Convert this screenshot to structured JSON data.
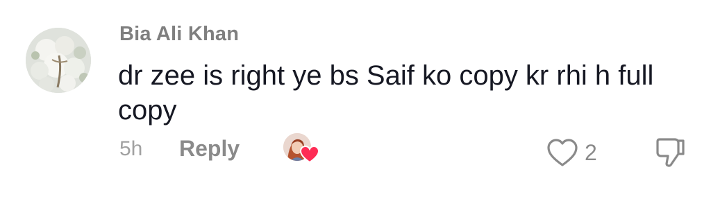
{
  "comment": {
    "username": "Bia Ali Khan",
    "text": "dr zee is right ye bs Saif ko copy kr rhi h full copy",
    "timestamp": "5h",
    "reply_label": "Reply",
    "like_count": "2",
    "creator_liked": true
  },
  "icons": {
    "avatar": "user-avatar-flowers",
    "creator_avatar": "creator-avatar",
    "creator_heart": "heart-icon",
    "like": "heart-outline-icon",
    "dislike": "thumbs-down-icon"
  },
  "colors": {
    "text_primary": "#161823",
    "text_secondary": "#8a8a8a",
    "heart_accent": "#fe2c55"
  }
}
